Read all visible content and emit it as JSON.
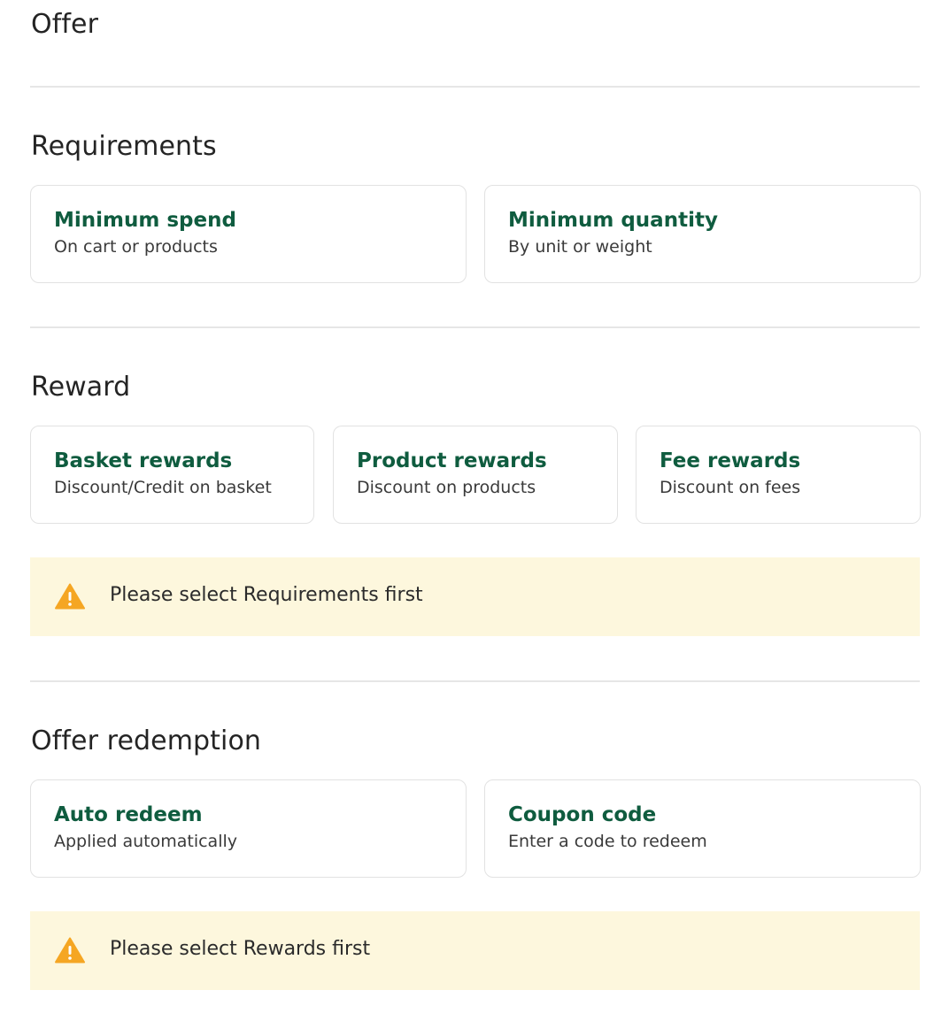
{
  "sections": {
    "offer": {
      "title": "Offer"
    },
    "requirements": {
      "title": "Requirements",
      "cards": [
        {
          "title": "Minimum spend",
          "subtitle": "On cart or products"
        },
        {
          "title": "Minimum quantity",
          "subtitle": "By unit or weight"
        }
      ]
    },
    "reward": {
      "title": "Reward",
      "cards": [
        {
          "title": "Basket rewards",
          "subtitle": "Discount/Credit on basket"
        },
        {
          "title": "Product rewards",
          "subtitle": "Discount on products"
        },
        {
          "title": "Fee rewards",
          "subtitle": "Discount on fees"
        }
      ],
      "alert": {
        "icon": "warning-icon",
        "text": "Please select Requirements first"
      }
    },
    "redemption": {
      "title": "Offer redemption",
      "cards": [
        {
          "title": "Auto redeem",
          "subtitle": "Applied automatically"
        },
        {
          "title": "Coupon code",
          "subtitle": "Enter a code to redeem"
        }
      ],
      "alert": {
        "icon": "warning-icon",
        "text": "Please select Rewards first"
      }
    }
  },
  "colors": {
    "card_title": "#0f5c3f",
    "alert_background": "#fdf7dd",
    "warning_icon": "#f5a623",
    "divider": "#e6e6e6"
  }
}
